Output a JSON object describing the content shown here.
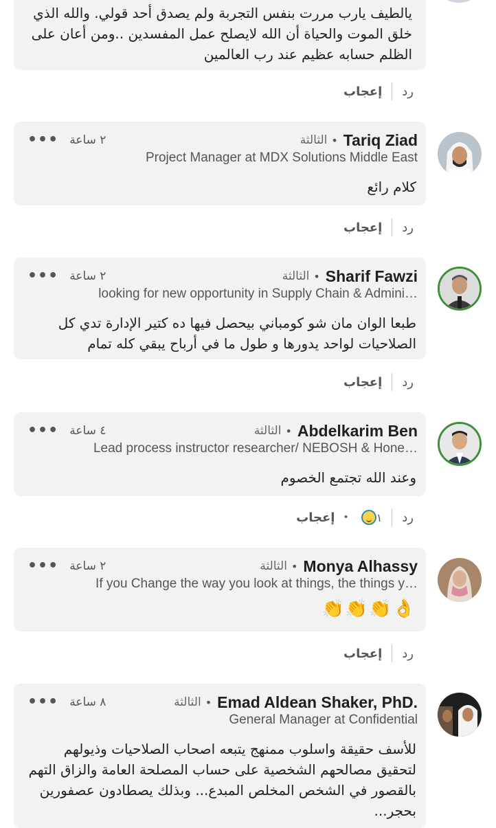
{
  "top_comment": {
    "text": "يالطيف يارب مررت بنفس التجربة ولم يصدق أحد قولي. والله الذي خلق الموت والحياة أن الله لايصلح عمل المفسدين ..ومن أعان على الظلم حسابه عظيم عند رب العالمين",
    "like_label": "إعجاب",
    "reply_label": "رد"
  },
  "comments": [
    {
      "name": "Tariq Ziad",
      "degree": "الثالثة",
      "time": "٢ ساعة",
      "headline": "Project Manager at MDX Solutions Middle East",
      "text": "كلام رائع",
      "like_label": "إعجاب",
      "reply_label": "رد"
    },
    {
      "name": "Sharif Fawzi",
      "degree": "الثالثة",
      "time": "٢ ساعة",
      "headline": "looking for new opportunity in Supply Chain & Admini…",
      "text": "طبعا الوان مان شو كومباني بيحصل فيها ده كتير  الإدارة تدي كل الصلاحيات لواحد يدورها و طول ما في أرباح يبقي كله تمام",
      "like_label": "إعجاب",
      "reply_label": "رد"
    },
    {
      "name": "Abdelkarim Ben",
      "degree": "الثالثة",
      "time": "٤ ساعة",
      "headline": "Lead process instructor researcher/ NEBOSH & Hone…",
      "text": "وعند الله تجتمع الخصوم",
      "like_label": "إعجاب",
      "reply_label": "رد",
      "reaction_count": "١"
    },
    {
      "name": "Monya Alhassy",
      "degree": "الثالثة",
      "time": "٢ ساعة",
      "headline": "If you Change the way you look at things, the things y…",
      "text": "👌👏👏👏",
      "like_label": "إعجاب",
      "reply_label": "رد"
    },
    {
      "name": "Emad Aldean Shaker, PhD.",
      "degree": "الثالثة",
      "time": "٨ ساعة",
      "headline": "General Manager at Confidential",
      "text": "للأسف حقيقة واسلوب ممنهج يتبعه اصحاب الصلاحيات وذيولهم لتحقيق مصالحهم الشخصية على حساب المصلحة العامة والزاق التهم بالقصور في الشخص المخلص المبدع... وبذلك يصطادون عصفورين بحجر..."
    }
  ],
  "more_label": "•••",
  "colors": {
    "bubble": "#f2f2f2",
    "badge": "#3f8f3a"
  }
}
